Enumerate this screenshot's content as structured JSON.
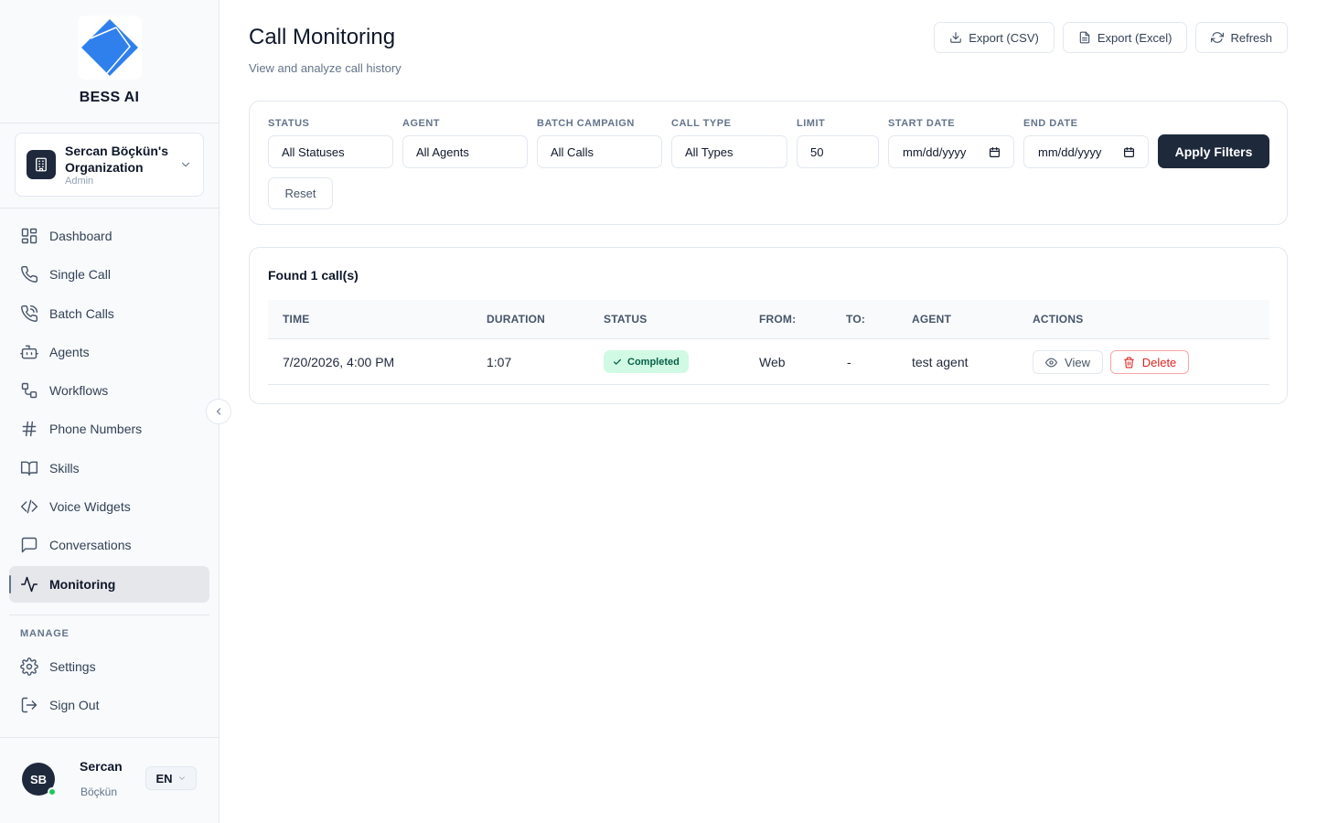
{
  "brand": {
    "name": "BESS AI",
    "logo_icon": "diamond-logo-icon",
    "logo_color": "#2f80ed"
  },
  "organization": {
    "name": "Sercan Böçkün's Organization",
    "role": "Admin"
  },
  "nav": {
    "items": [
      {
        "label": "Dashboard",
        "icon": "dashboard-icon"
      },
      {
        "label": "Single Call",
        "icon": "phone-icon"
      },
      {
        "label": "Batch Calls",
        "icon": "phone-outgoing-icon"
      },
      {
        "label": "Agents",
        "icon": "bot-icon"
      },
      {
        "label": "Workflows",
        "icon": "workflow-icon"
      },
      {
        "label": "Phone Numbers",
        "icon": "hash-icon"
      },
      {
        "label": "Skills",
        "icon": "book-icon"
      },
      {
        "label": "Voice Widgets",
        "icon": "code-icon"
      },
      {
        "label": "Conversations",
        "icon": "message-square-icon"
      },
      {
        "label": "Monitoring",
        "icon": "activity-icon",
        "active": true
      }
    ],
    "manage_label": "MANAGE",
    "manage_items": [
      {
        "label": "Settings",
        "icon": "gear-icon"
      },
      {
        "label": "Sign Out",
        "icon": "sign-out-icon"
      }
    ]
  },
  "user": {
    "initials": "SB",
    "first_name": "Sercan",
    "last_name": "Böçkün",
    "language": "EN",
    "status_color": "#22c55e"
  },
  "header": {
    "title": "Call Monitoring",
    "subtitle": "View and analyze call history",
    "export_csv": "Export (CSV)",
    "export_excel": "Export (Excel)",
    "refresh": "Refresh"
  },
  "filters": {
    "status": {
      "label": "STATUS",
      "value": "All Statuses"
    },
    "agent": {
      "label": "AGENT",
      "value": "All Agents"
    },
    "batch_campaign": {
      "label": "BATCH CAMPAIGN",
      "value": "All Calls"
    },
    "call_type": {
      "label": "CALL TYPE",
      "value": "All Types"
    },
    "limit": {
      "label": "LIMIT",
      "value": "50"
    },
    "start_date": {
      "label": "START DATE",
      "placeholder": "mm/dd/yyyy"
    },
    "end_date": {
      "label": "END DATE",
      "placeholder": "mm/dd/yyyy"
    },
    "apply_label": "Apply Filters",
    "reset_label": "Reset"
  },
  "results": {
    "found_text": "Found 1 call(s)",
    "columns": [
      "TIME",
      "DURATION",
      "STATUS",
      "FROM:",
      "TO:",
      "AGENT",
      "ACTIONS"
    ],
    "rows": [
      {
        "time": "7/20/2026, 4:00 PM",
        "duration": "1:07",
        "status": "Completed",
        "from": "Web",
        "to": "-",
        "agent": "test agent",
        "view_label": "View",
        "delete_label": "Delete"
      }
    ]
  },
  "colors": {
    "primary": "#1e293b",
    "success_bg": "#d1fae5",
    "success_text": "#065f46",
    "danger": "#dc2626"
  }
}
